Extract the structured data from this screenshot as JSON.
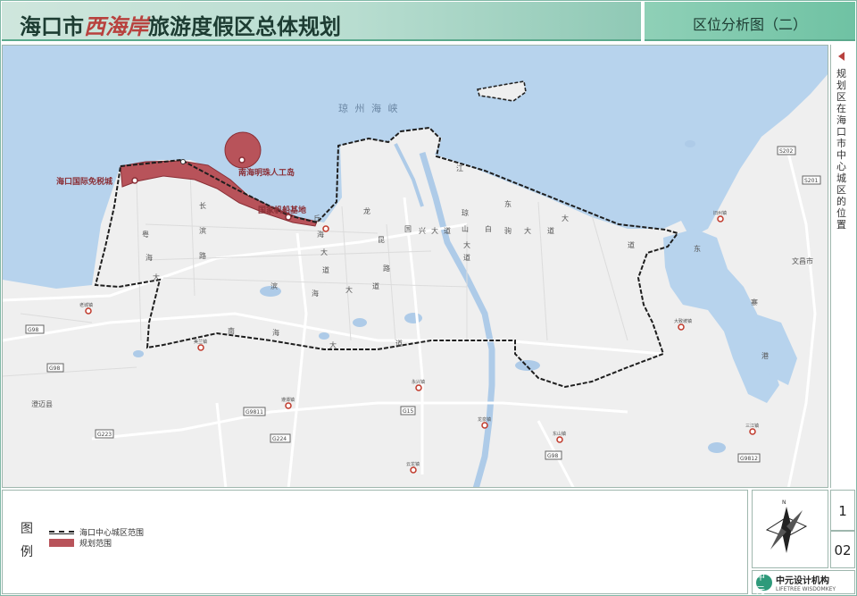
{
  "header": {
    "title_prefix": "海口市",
    "title_emphasis": "西海岸",
    "title_suffix": "旅游度假区总体规划",
    "subtitle": "区位分析图（二）"
  },
  "side_note": "规划区在海口市中心城区的位置",
  "map": {
    "sea_label": "琼 州 海 峡",
    "places": {
      "duty_free": "海口国际免税城",
      "pearl_island": "南海明珠人工岛",
      "sailing_base": "国家帆船基地",
      "chengmai": "澄迈县",
      "wenchang": "文昌市"
    },
    "roads": {
      "changbin": [
        "长",
        "滨",
        "路"
      ],
      "yuehai": [
        "粤",
        "海",
        "大",
        "道"
      ],
      "qiuhai": [
        "丘",
        "海",
        "大",
        "道"
      ],
      "binhai": [
        "滨",
        "海",
        "大",
        "道"
      ],
      "longkun": [
        "龙",
        "昆",
        "路"
      ],
      "guoxing": [
        "国",
        "兴",
        "大",
        "道"
      ],
      "qiongshan": [
        "琼",
        "山",
        "大",
        "道"
      ],
      "nanhai": [
        "南",
        "海",
        "大",
        "道"
      ],
      "baiju": [
        "白",
        "驹",
        "大",
        "道"
      ],
      "jiang": [
        "江"
      ],
      "dongchang": [
        "东",
        "大",
        "道"
      ],
      "dongzhai": [
        "东",
        "寨",
        "港"
      ]
    },
    "highway_badges": [
      "G224",
      "G98",
      "G9811",
      "G15",
      "G223",
      "G98",
      "G9812",
      "G98",
      "S202",
      "S201"
    ],
    "towns": [
      "老城镇",
      "美兰镇",
      "遵谭镇",
      "永兴镇",
      "龙泉镇",
      "东山镇",
      "云龙镇",
      "大致坡镇",
      "三江镇",
      "旧州镇",
      "演丰镇",
      "新坡镇"
    ],
    "colors": {
      "sea": "#b7d3ed",
      "land": "#efefef",
      "planning": "#b8535a",
      "boundary": "#1e1e1e",
      "road": "#ffffff",
      "water": "#aecbe8"
    }
  },
  "legend": {
    "title": "图例",
    "items": [
      {
        "label": "海口中心城区范围",
        "kind": "dashed-boundary"
      },
      {
        "label": "规划范围",
        "kind": "filled-area"
      }
    ]
  },
  "page": {
    "sheet": "1",
    "number": "02"
  },
  "compass": {
    "north": "N"
  },
  "logo": {
    "cn": "中元设计机构",
    "en": "LIFETREE WISDOMKEY",
    "mark": "中元"
  }
}
